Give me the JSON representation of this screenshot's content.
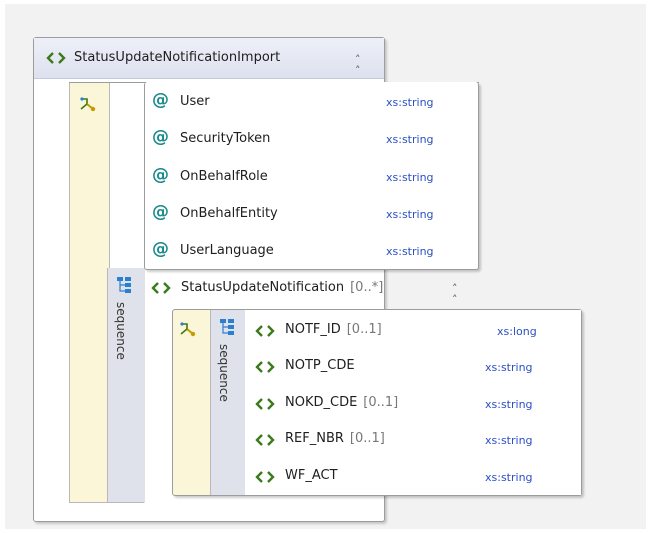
{
  "root": {
    "name": "StatusUpdateNotificationImport",
    "collapse_icon": "double-chevron-up-icon"
  },
  "attributes": [
    {
      "name": "User",
      "type": "xs:string"
    },
    {
      "name": "SecurityToken",
      "type": "xs:string"
    },
    {
      "name": "OnBehalfRole",
      "type": "xs:string"
    },
    {
      "name": "OnBehalfEntity",
      "type": "xs:string"
    },
    {
      "name": "UserLanguage",
      "type": "xs:string"
    }
  ],
  "outer_sequence": {
    "label": "sequence"
  },
  "child_element": {
    "name": "StatusUpdateNotification",
    "multiplicity": "[0..*]",
    "collapse_icon": "double-chevron-up-icon"
  },
  "inner_sequence": {
    "label": "sequence",
    "elements": [
      {
        "name": "NOTF_ID",
        "multiplicity": "[0..1]",
        "type": "xs:long"
      },
      {
        "name": "NOTP_CDE",
        "multiplicity": "",
        "type": "xs:string"
      },
      {
        "name": "NOKD_CDE",
        "multiplicity": "[0..1]",
        "type": "xs:string"
      },
      {
        "name": "REF_NBR",
        "multiplicity": "[0..1]",
        "type": "xs:string"
      },
      {
        "name": "WF_ACT",
        "multiplicity": "",
        "type": "xs:string"
      }
    ]
  },
  "colors": {
    "attribute_icon": "#1a8a8c",
    "element_icon": "#3b7a1a",
    "type_text": "#2b4fc8",
    "complex_type_fill": "#fbf6d8",
    "sequence_fill": "#dfe2ea"
  }
}
